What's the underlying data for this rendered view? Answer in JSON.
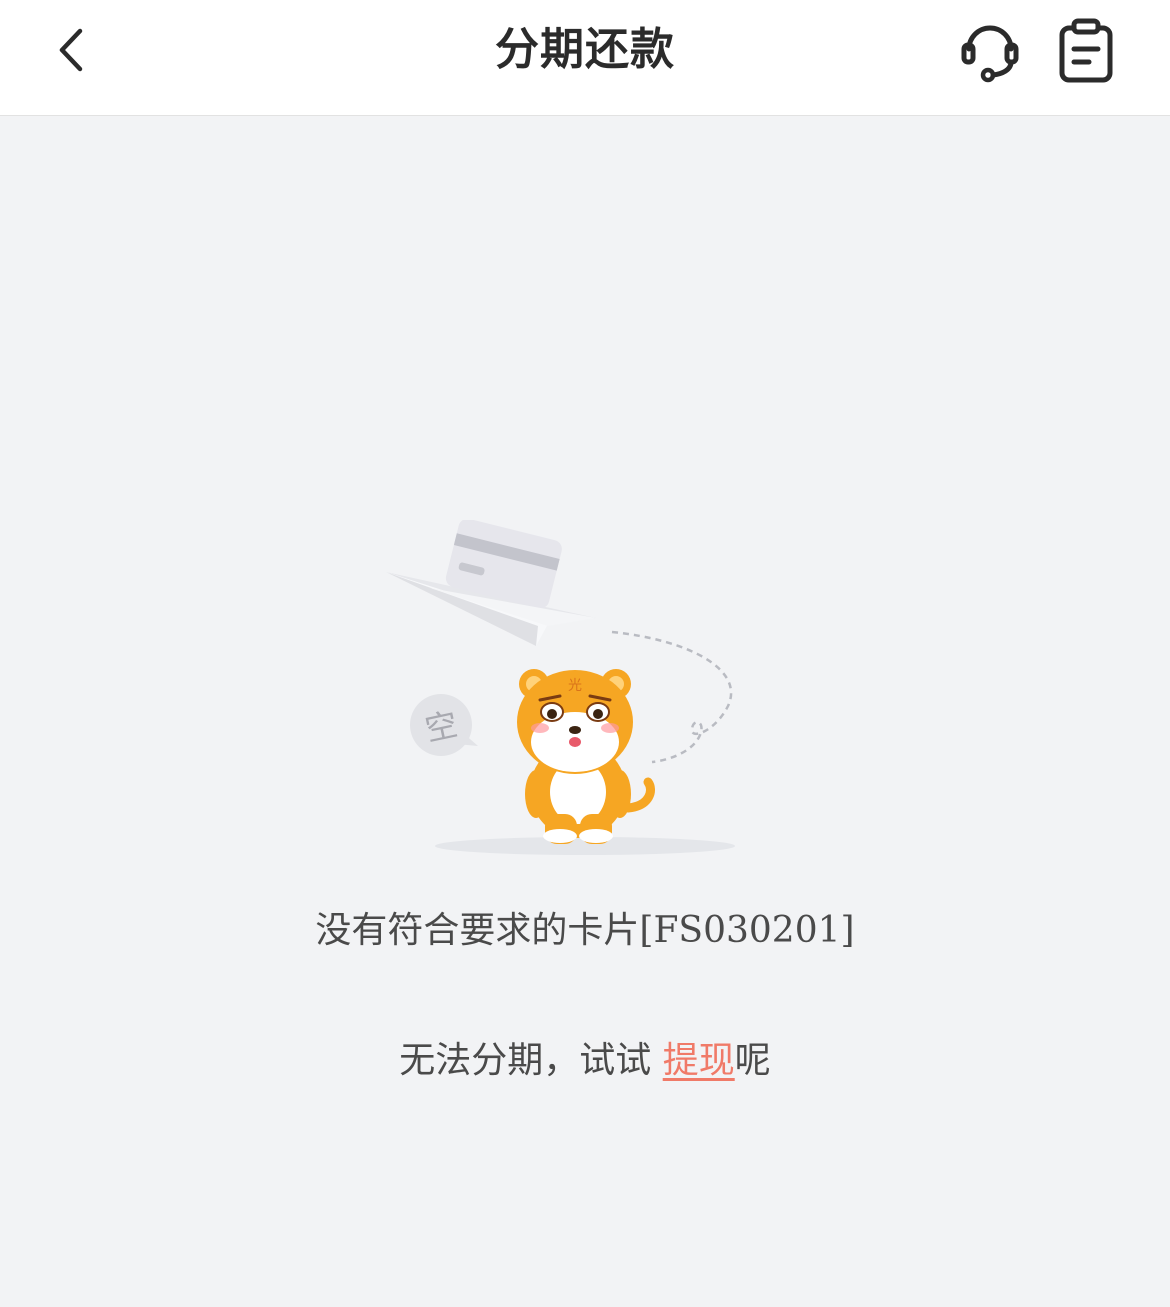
{
  "header": {
    "title": "分期还款"
  },
  "illustration": {
    "bubble_text": "空",
    "badge_text": "光"
  },
  "empty_state": {
    "message": "没有符合要求的卡片[FS030201]",
    "hint_prefix": "无法分期，试试 ",
    "hint_link": "提现",
    "hint_suffix": "呢"
  },
  "colors": {
    "background": "#f2f3f5",
    "link": "#f07a68",
    "tiger": "#f6a623"
  }
}
